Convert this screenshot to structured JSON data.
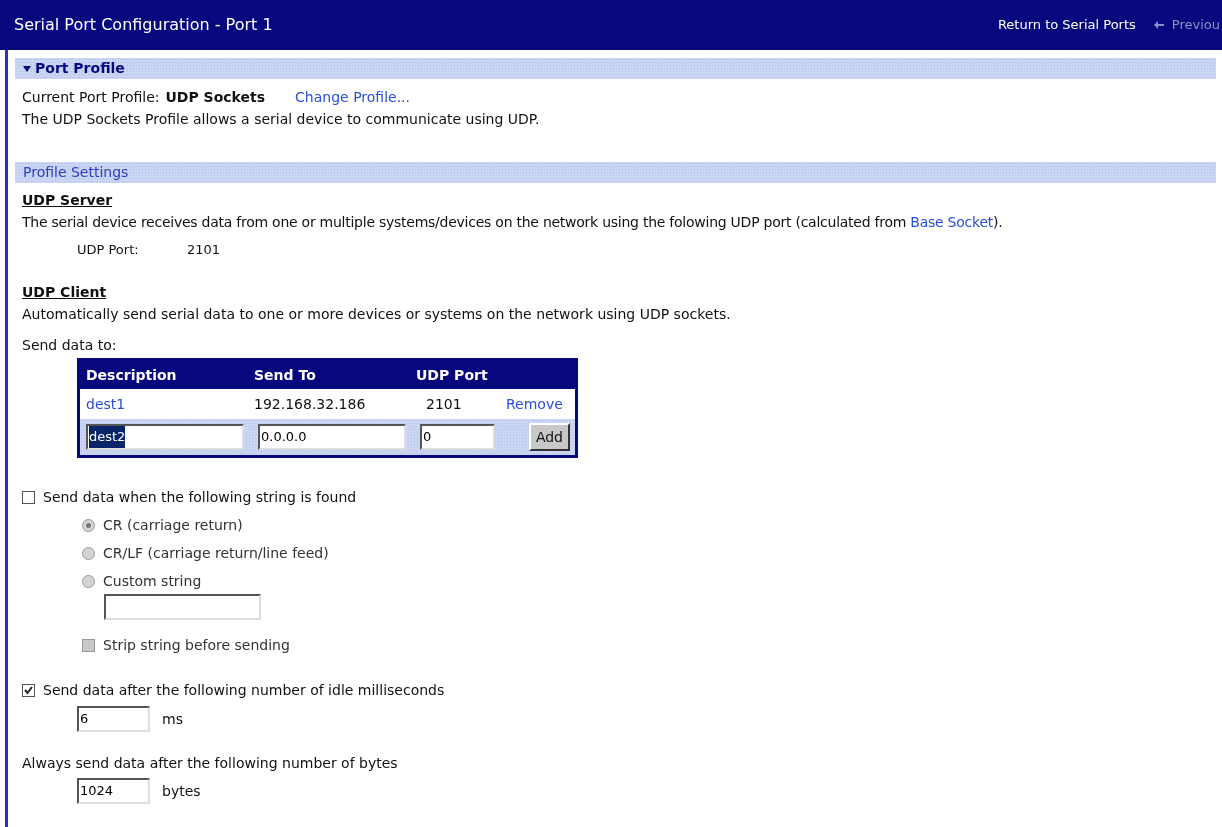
{
  "header": {
    "title": "Serial Port Configuration - Port 1",
    "return_link": "Return to Serial Ports",
    "previous": {
      "label": "Previou",
      "disabled": true
    }
  },
  "port_profile": {
    "title": "Port Profile",
    "expanded": true,
    "current_label": "Current Port Profile:",
    "current_value": "UDP Sockets",
    "change_link": "Change Profile...",
    "description": "The UDP Sockets Profile allows a serial device to communicate using UDP."
  },
  "profile_settings": {
    "title": "Profile Settings",
    "udp_server": {
      "title": "UDP Server",
      "description_before": "The serial device receives data from one or multiple systems/devices on the network using the folowing UDP port (calculated from",
      "description_link": "Base Socket",
      "description_after": ").",
      "port_label": "UDP Port:",
      "port_value": "2101"
    },
    "udp_client": {
      "title": "UDP Client",
      "description": "Automatically send serial data to one or more devices or systems on the network using UDP sockets.",
      "send_to_label": "Send data to:",
      "columns": [
        "Description",
        "Send To",
        "UDP Port"
      ],
      "rows": [
        {
          "description": "dest1",
          "send_to": "192.168.32.186",
          "udp_port": "2101",
          "action": "Remove"
        }
      ],
      "new_row": {
        "description": "dest2",
        "description_highlighted": true,
        "send_to": "0.0.0.0",
        "udp_port": "0",
        "button": "Add"
      }
    },
    "string_trigger": {
      "label": "Send data when the following string is found",
      "checked": false,
      "options": [
        {
          "label": "CR (carriage return)",
          "selected": true,
          "disabled": true
        },
        {
          "label": "CR/LF (carriage return/line feed)",
          "selected": false,
          "disabled": true
        },
        {
          "label": "Custom string",
          "selected": false,
          "disabled": true
        }
      ],
      "strip": {
        "label": "Strip string before sending",
        "checked": false,
        "disabled": true
      }
    },
    "idle_trigger": {
      "label": "Send data after the following number of idle milliseconds",
      "checked": true,
      "value": "6",
      "unit": "ms"
    },
    "bytes_trigger": {
      "label": "Always send data after the following number of bytes",
      "value": "1024",
      "unit": "bytes"
    }
  }
}
